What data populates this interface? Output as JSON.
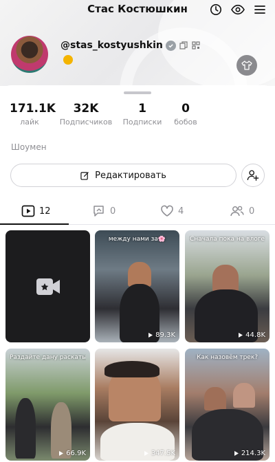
{
  "header": {
    "title": "Стас Костюшкин",
    "username": "@stas_kostyushkin"
  },
  "stats": [
    {
      "value": "171.1K",
      "label": "лайк"
    },
    {
      "value": "32K",
      "label": "Подписчиков"
    },
    {
      "value": "1",
      "label": "Подписки"
    },
    {
      "value": "0",
      "label": "бобов"
    }
  ],
  "bio": "Шоумен",
  "actions": {
    "edit_label": "Редактировать"
  },
  "tabs": [
    {
      "icon": "play-square-icon",
      "count": "12"
    },
    {
      "icon": "repost-icon",
      "count": "0"
    },
    {
      "icon": "heart-icon",
      "count": "4"
    },
    {
      "icon": "people-icon",
      "count": "0"
    }
  ],
  "videos": [
    {
      "caption": "",
      "views": ""
    },
    {
      "caption": "между нами за🌸",
      "views": "89.3K"
    },
    {
      "caption": "Сначала пока на влоге",
      "views": "44.8K"
    },
    {
      "caption": "Раздайте дану раскаты",
      "views": "66.9K"
    },
    {
      "caption": "",
      "views": "347.5K"
    },
    {
      "caption": "Как назовём трек?",
      "views": "214.3K"
    }
  ],
  "colors": {
    "accent": "#111111",
    "muted": "#8e8e93",
    "border": "#d1d1d6"
  }
}
